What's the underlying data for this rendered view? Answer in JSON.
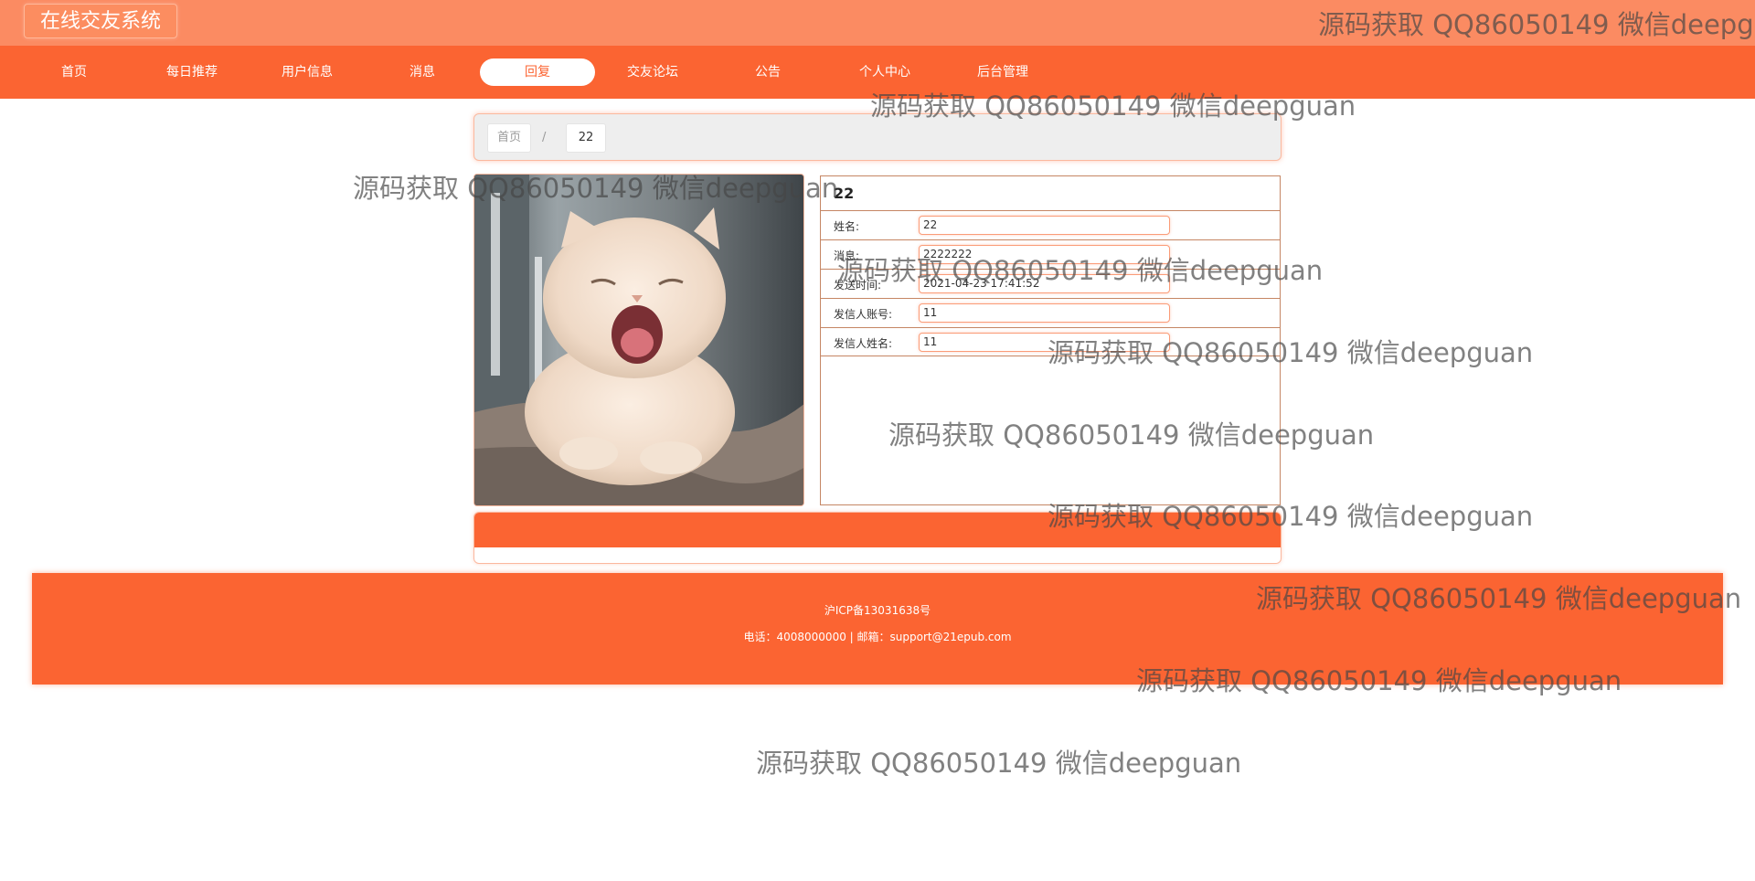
{
  "app": {
    "title": "在线交友系统"
  },
  "nav": {
    "items": [
      {
        "label": "首页"
      },
      {
        "label": "每日推荐"
      },
      {
        "label": "用户信息"
      },
      {
        "label": "消息"
      },
      {
        "label": "回复",
        "active": true
      },
      {
        "label": "交友论坛"
      },
      {
        "label": "公告"
      },
      {
        "label": "个人中心"
      },
      {
        "label": "后台管理"
      }
    ]
  },
  "breadcrumb": {
    "home": "首页",
    "separator": "/",
    "current": "22"
  },
  "detail": {
    "image": "photo of a cream-colored cat yawning on a sofa",
    "title": "22",
    "fields": [
      {
        "label": "姓名:",
        "value": "22"
      },
      {
        "label": "消息:",
        "value": "2222222"
      },
      {
        "label": "发送时间:",
        "value": "2021-04-23 17:41:52"
      },
      {
        "label": "发信人账号:",
        "value": "11"
      },
      {
        "label": "发信人姓名:",
        "value": "11"
      }
    ]
  },
  "footer": {
    "icp": "沪ICP备13031638号",
    "contact": "电话：4008000000 | 邮箱：support@21epub.com"
  },
  "watermarks": [
    "源码获取 QQ86050149 微信deepg",
    "源码获取 QQ86050149 微信deepguan",
    "源码获取 QQ86050149 微信deepguan",
    "源码获取 QQ86050149 微信deepguan",
    "源码获取 QQ86050149 微信deepguan",
    "源码获取 QQ86050149 微信deepguan",
    "源码获取 QQ86050149 微信deepguan",
    "源码获取 QQ86050149 微信deepguan",
    "源码获取 QQ86050149 微信deepguan",
    "源码获取 QQ86050149 微信deepguan"
  ],
  "colors": {
    "brand_orange": "#fb6432",
    "topbar_orange": "#fb8b62",
    "panel_border": "#c58664"
  }
}
